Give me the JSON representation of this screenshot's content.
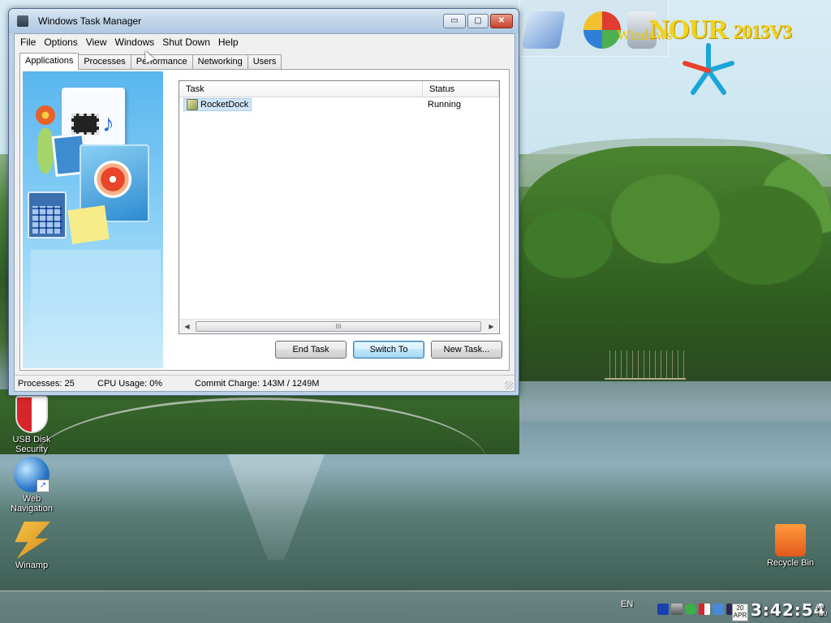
{
  "window": {
    "title": "Windows Task Manager",
    "controls": {
      "minimize": "▭",
      "maximize": "▢",
      "close": "✕"
    }
  },
  "menu": [
    "File",
    "Options",
    "View",
    "Windows",
    "Shut Down",
    "Help"
  ],
  "tabs": [
    "Applications",
    "Processes",
    "Performance",
    "Networking",
    "Users"
  ],
  "active_tab": "Applications",
  "tasks": {
    "columns": [
      "Task",
      "Status"
    ],
    "rows": [
      {
        "task": "RocketDock",
        "status": "Running"
      }
    ]
  },
  "scroll_thumb": "III",
  "buttons": {
    "end_task": "End Task",
    "switch_to": "Switch To",
    "new_task": "New Task..."
  },
  "status_bar": {
    "processes": "Processes: 25",
    "cpu": "CPU Usage: 0%",
    "commit": "Commit Charge: 143M / 1249M"
  },
  "desktop_icons": [
    {
      "label": "USB Disk Security"
    },
    {
      "label": "Web Navigation"
    },
    {
      "label": "Winamp"
    },
    {
      "label": "Recycle Bin"
    }
  ],
  "brand": {
    "prefix": "Windows",
    "name": "NOUR",
    "version": "2013V3"
  },
  "taskbar": {
    "language": "EN",
    "date_day": "20",
    "date_month": "APR",
    "weekday": "THU",
    "clock": "3:42:54",
    "ampm": "AM"
  },
  "colors": {
    "selection": "#d2e6f9",
    "title_bar": "#c2d6ea",
    "brand_text": "#f2d21a"
  }
}
